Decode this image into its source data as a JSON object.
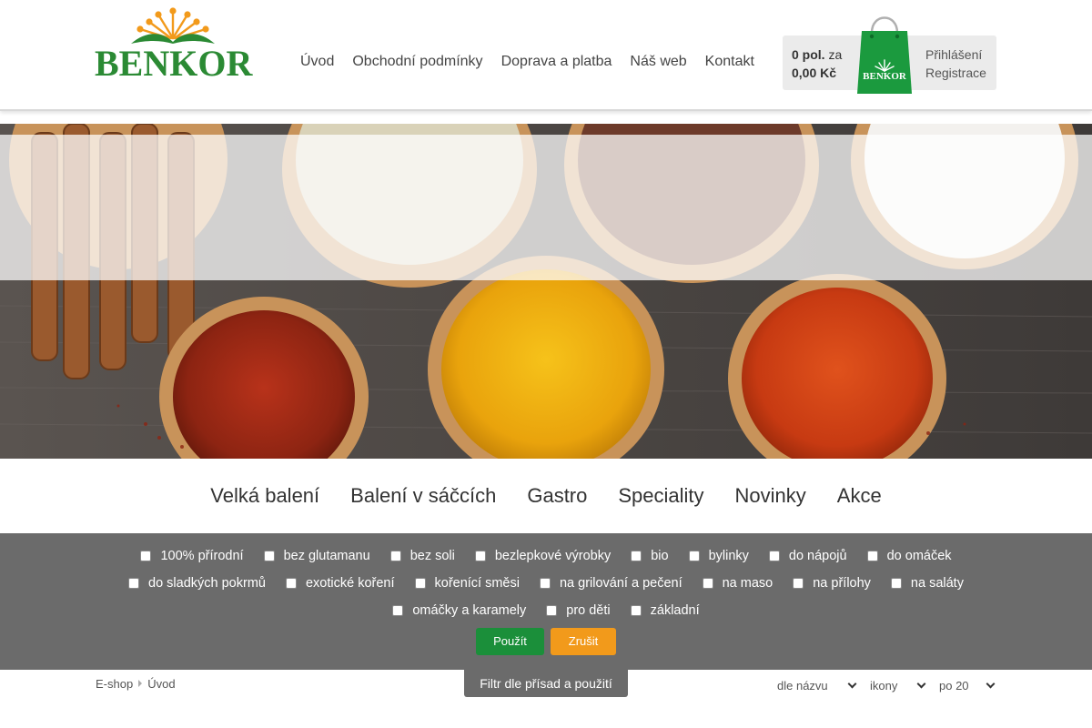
{
  "brand": {
    "logo_text": "BENKOR",
    "accent": "#2b8a34",
    "flower_color": "#f29a1b"
  },
  "nav": [
    {
      "label": "Úvod"
    },
    {
      "label": "Obchodní podmínky"
    },
    {
      "label": "Doprava a platba"
    },
    {
      "label": "Náš web"
    },
    {
      "label": "Kontakt"
    }
  ],
  "cart": {
    "count_bold": "0 pol.",
    "count_suffix": " za",
    "price": "0,00 Kč",
    "bag_label": "BENKOR",
    "login": "Přihlášení",
    "register": "Registrace"
  },
  "categories": [
    {
      "label": "Velká balení"
    },
    {
      "label": "Balení v sáčcích"
    },
    {
      "label": "Gastro"
    },
    {
      "label": "Speciality"
    },
    {
      "label": "Novinky"
    },
    {
      "label": "Akce"
    }
  ],
  "filters": {
    "row1": [
      "100% přírodní",
      "bez glutamanu",
      "bez soli",
      "bezlepkové výrobky",
      "bio",
      "bylinky",
      "do nápojů",
      "do omáček"
    ],
    "row2": [
      "do sladkých pokrmů",
      "exotické koření",
      "kořenící směsi",
      "na grilování a pečení",
      "na maso",
      "na přílohy",
      "na saláty"
    ],
    "row3": [
      "omáčky a karamely",
      "pro děti",
      "základní"
    ],
    "apply_label": "Použít",
    "cancel_label": "Zrušit",
    "tab_label": "Filtr dle přísad a použití"
  },
  "breadcrumb": {
    "root": "E-shop",
    "current": "Úvod"
  },
  "sorting": {
    "sort_by": "dle názvu",
    "view": "ikony",
    "per_page": "po 20"
  }
}
